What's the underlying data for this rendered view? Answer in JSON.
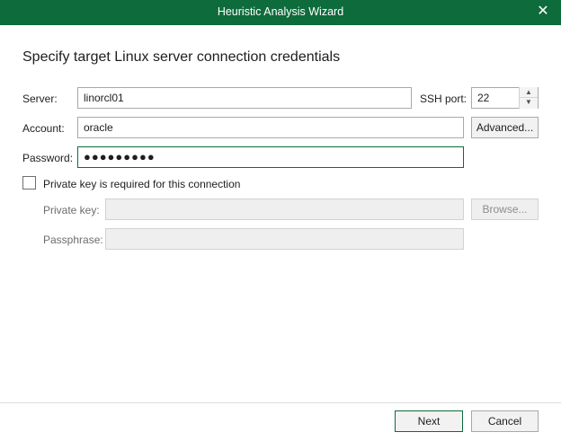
{
  "window": {
    "title": "Heuristic Analysis Wizard"
  },
  "heading": "Specify target Linux server connection credentials",
  "form": {
    "server_label": "Server:",
    "server_value": "linorcl01",
    "ssh_port_label": "SSH port:",
    "ssh_port_value": "22",
    "account_label": "Account:",
    "account_value": "oracle",
    "advanced_label": "Advanced...",
    "password_label": "Password:",
    "password_mask": "●●●●●●●●●",
    "private_key_checkbox_label": "Private key is required for this connection",
    "private_key_checked": false,
    "private_key_label": "Private key:",
    "private_key_value": "",
    "browse_label": "Browse...",
    "passphrase_label": "Passphrase:",
    "passphrase_value": ""
  },
  "footer": {
    "next_label": "Next",
    "cancel_label": "Cancel"
  },
  "colors": {
    "titlebar": "#0e6b3c",
    "focus_border": "#0e6b3c"
  },
  "icons": {
    "close": "close-icon",
    "spin_up": "chevron-up-icon",
    "spin_down": "chevron-down-icon"
  }
}
